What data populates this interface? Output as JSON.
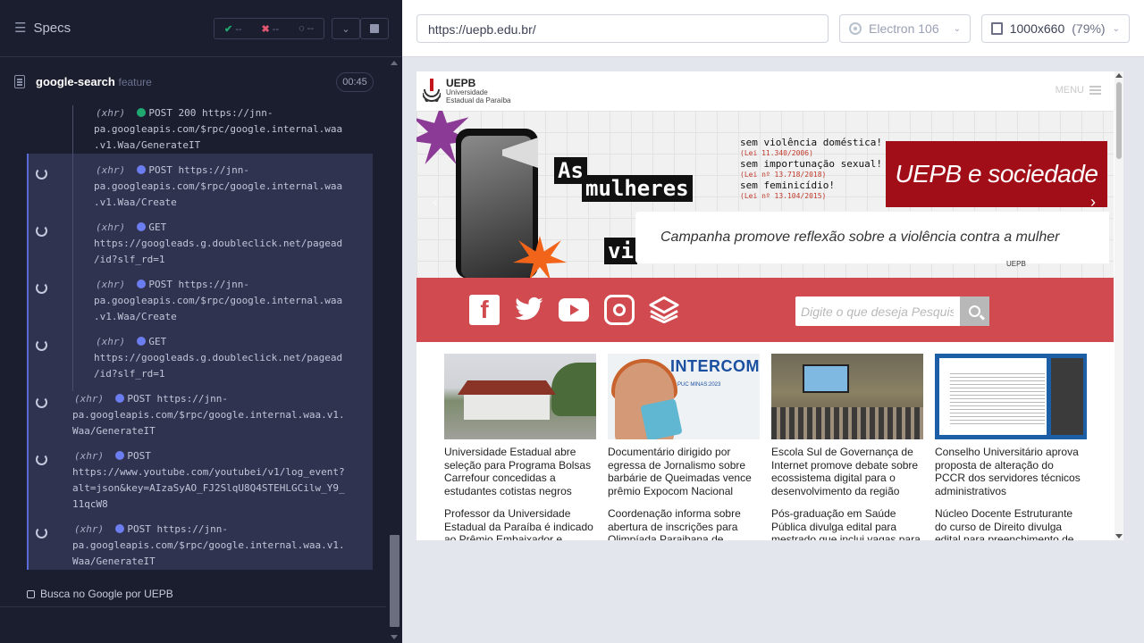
{
  "runner": {
    "specs_label": "Specs",
    "stats": {
      "passed": "--",
      "failed": "--",
      "pending": "--"
    },
    "spec_file": {
      "name": "google-search",
      "ext": "feature",
      "duration": "00:45"
    },
    "test_title": "Busca no Google por UEPB",
    "log": [
      {
        "type": "(xhr)",
        "status": "green",
        "lines": [
          "POST 200 https://jnn-",
          "pa.googleapis.com/$rpc/google.internal.waa",
          ".v1.Waa/GenerateIT"
        ]
      },
      {
        "type": "(xhr)",
        "status": "blue",
        "lines": [
          "POST https://jnn-",
          "pa.googleapis.com/$rpc/google.internal.waa",
          ".v1.Waa/Create"
        ]
      },
      {
        "type": "(xhr)",
        "status": "blue",
        "lines": [
          "GET",
          "https://googleads.g.doubleclick.net/pagead",
          "/id?slf_rd=1"
        ]
      },
      {
        "type": "(xhr)",
        "status": "blue",
        "lines": [
          "POST https://jnn-",
          "pa.googleapis.com/$rpc/google.internal.waa",
          ".v1.Waa/Create"
        ]
      },
      {
        "type": "(xhr)",
        "status": "blue",
        "lines": [
          "GET",
          "https://googleads.g.doubleclick.net/pagead",
          "/id?slf_rd=1"
        ]
      },
      {
        "type": "(xhr)",
        "status": "blue",
        "lines": [
          "POST https://jnn-",
          "pa.googleapis.com/$rpc/google.internal.waa.v1.",
          "Waa/GenerateIT"
        ]
      },
      {
        "type": "(xhr)",
        "status": "blue",
        "lines": [
          "POST",
          "https://www.youtube.com/youtubei/v1/log_event?",
          "alt=json&key=AIzaSyAO_FJ2SlqU8Q4STEHLGCilw_Y9_",
          "11qcW8"
        ]
      },
      {
        "type": "(xhr)",
        "status": "blue",
        "lines": [
          "POST https://jnn-",
          "pa.googleapis.com/$rpc/google.internal.waa.v1.",
          "Waa/GenerateIT"
        ]
      }
    ]
  },
  "browser_bar": {
    "url": "https://uepb.edu.br/",
    "browser": "Electron 106",
    "viewport": "1000x660",
    "scale": "(79%)"
  },
  "site": {
    "logo_title": "UEPB",
    "logo_subtitle_1": "Universidade",
    "logo_subtitle_2": "Estadual da Paraíba",
    "menu_label": "MENU",
    "banner": {
      "slogan_1": "As",
      "slogan_2": "mulheres",
      "slogan_3": "vi",
      "law_1": "sem violência doméstica!",
      "law_1_ref": "(Lei 11.340/2006)",
      "law_2": "sem importunação sexual!",
      "law_2_ref": "(Lei nº 13.718/2018)",
      "law_3": "sem feminicídio!",
      "law_3_ref": "(Lei nº 13.104/2015)",
      "headline": "UEPB e sociedade",
      "caption": "Campanha promove reflexão sobre a violência contra a mulher",
      "footer": "UEPB"
    },
    "search_placeholder": "Digite o que deseja Pesquisar...",
    "colors": {
      "social_bar": "#d04a4f",
      "banner_red": "#a20e17"
    },
    "news": [
      {
        "title": "Universidade Estadual abre seleção para Programa Bolsas Carrefour concedidas a estudantes cotistas negros",
        "next": "Professor da Universidade Estadual da Paraíba é indicado ao Prêmio Embaixador e"
      },
      {
        "title": "Documentário dirigido por egressa de Jornalismo sobre barbárie de Queimadas vence prêmio Expocom Nacional",
        "next": "Coordenação informa sobre abertura de inscrições para Olimpíada Paraibana de",
        "thumb_label": "INTERCOM",
        "thumb_sub": "PUC MINAS:2023"
      },
      {
        "title": "Escola Sul de Governança de Internet promove debate sobre ecossistema digital para o desenvolvimento da região",
        "next": "Pós-graduação em Saúde Pública divulga edital para mestrado que inclui vagas para"
      },
      {
        "title": "Conselho Universitário aprova proposta de alteração do PCCR dos servidores técnicos administrativos",
        "next": "Núcleo Docente Estruturante do curso de Direito divulga edital para preenchimento de"
      }
    ]
  }
}
